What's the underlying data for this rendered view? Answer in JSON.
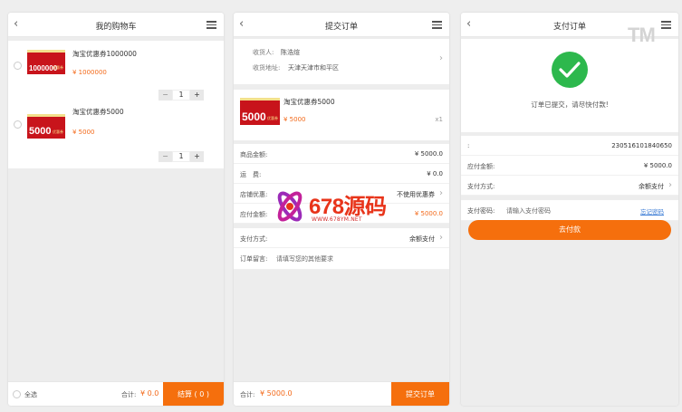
{
  "cart": {
    "title": "我的购物车",
    "items": [
      {
        "name": "淘宝优惠券1000000",
        "coupon_amount": "1000000",
        "coupon_tag": "优惠券",
        "price": "¥ 1000000",
        "qty": "1",
        "minus": "−",
        "plus": "+"
      },
      {
        "name": "淘宝优惠券5000",
        "coupon_amount": "5000",
        "coupon_tag": "优惠券",
        "price": "¥ 5000",
        "qty": "1",
        "minus": "−",
        "plus": "+"
      }
    ],
    "select_all": "全选",
    "total_label": "合计:",
    "total_value": "¥ 0.0",
    "checkout": "结算 ( 0 )"
  },
  "order": {
    "title": "提交订单",
    "recipient_label": "收货人:",
    "recipient": "陈浩煊",
    "address_label": "收货地址:",
    "address": "天津天津市和平区",
    "product": {
      "name": "淘宝优惠券5000",
      "coupon_amount": "5000",
      "coupon_tag": "优惠券",
      "price": "¥ 5000",
      "qty": "x1"
    },
    "rows": [
      {
        "label": "商品金额:",
        "value": "¥ 5000.0"
      },
      {
        "label": "运　费:",
        "value": "¥ 0.0"
      },
      {
        "label": "店铺优惠:",
        "value": "不使用优惠券"
      },
      {
        "label": "应付金额:",
        "value": "¥ 5000.0"
      },
      {
        "label": "支付方式:",
        "value": "余额支付"
      }
    ],
    "note_label": "订单留言:",
    "note_placeholder": "请填写您的其他要求",
    "total_label": "合计:",
    "total_value": "¥ 5000.0",
    "submit": "提交订单"
  },
  "payment": {
    "title": "支付订单",
    "status": "订单已提交，请尽快付款!",
    "order_no_label": ":",
    "order_no": "230516101840650",
    "amount_label": "应付金额:",
    "amount": "¥ 5000.0",
    "method_label": "支付方式:",
    "method": "余额支付",
    "password_label": "支付密码:",
    "password_placeholder": "请输入支付密码",
    "forgot": "忘记密码",
    "pay_button": "去付款"
  },
  "watermark": {
    "brand": "678源码",
    "url": "WWW.678YM.NET",
    "tm": "TM"
  },
  "colors": {
    "accent": "#f56f0d",
    "price": "#f36a1b",
    "success": "#2db84d",
    "link": "#3a7bd5"
  }
}
